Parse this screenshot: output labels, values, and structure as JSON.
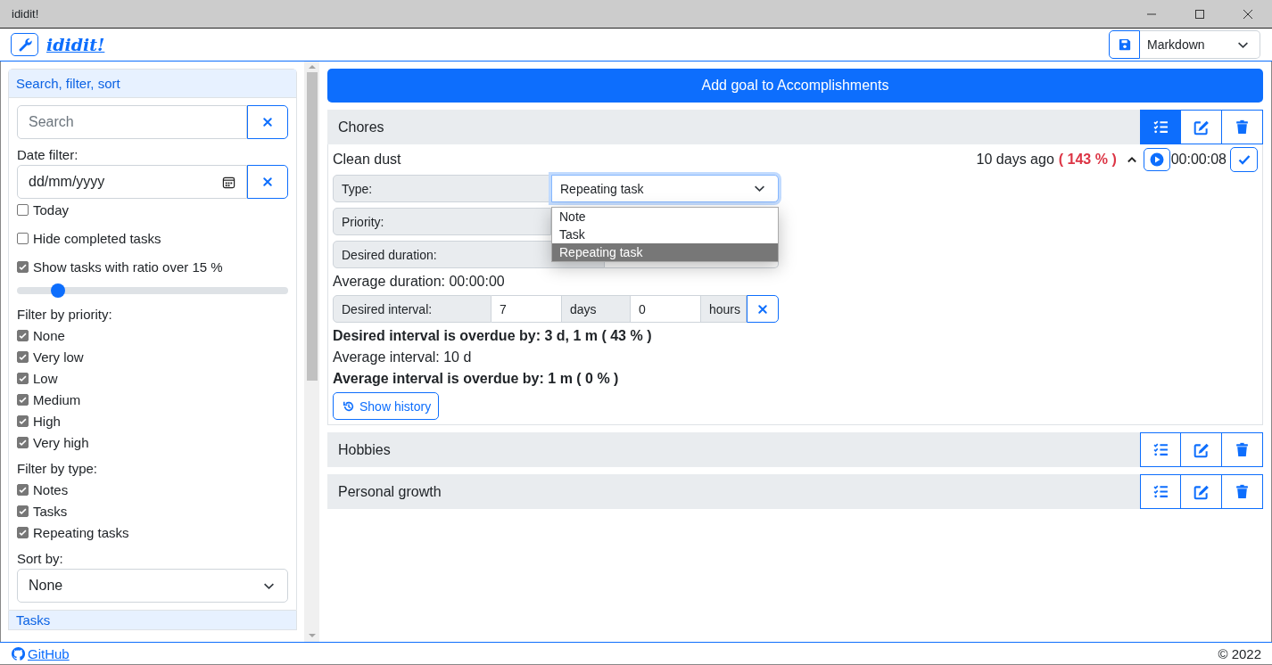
{
  "window": {
    "title": "ididit!"
  },
  "header": {
    "logo": "ididit!",
    "export_format": "Markdown"
  },
  "sidebar": {
    "title": "Search, filter, sort",
    "search_placeholder": "Search",
    "date_label": "Date filter:",
    "date_placeholder": "dd/mm/yyyy",
    "options": [
      {
        "label": "Today",
        "checked": false
      },
      {
        "label": "Hide completed tasks",
        "checked": false
      },
      {
        "label": "Show tasks with ratio over 15 %",
        "checked": true
      }
    ],
    "ratio": {
      "level": 0.15
    },
    "priority_title": "Filter by priority:",
    "priorities": [
      {
        "label": "None",
        "checked": true
      },
      {
        "label": "Very low",
        "checked": true
      },
      {
        "label": "Low",
        "checked": true
      },
      {
        "label": "Medium",
        "checked": true
      },
      {
        "label": "High",
        "checked": true
      },
      {
        "label": "Very high",
        "checked": true
      }
    ],
    "type_title": "Filter by type:",
    "types": [
      {
        "label": "Notes",
        "checked": true
      },
      {
        "label": "Tasks",
        "checked": true
      },
      {
        "label": "Repeating tasks",
        "checked": true
      }
    ],
    "sort_label": "Sort by:",
    "sort_value": "None",
    "next_section": "Tasks"
  },
  "main": {
    "add_button": "Add goal to Accomplishments",
    "goals": [
      {
        "name": "Chores",
        "expanded": true,
        "tasks": [
          {
            "name": "Clean dust",
            "last_done": "10 days ago",
            "ratio": "( 143 % )",
            "timer": "00:00:08",
            "type_label": "Type:",
            "type_value": "Repeating task",
            "type_options": [
              {
                "label": "Note",
                "selected": false
              },
              {
                "label": "Task",
                "selected": false
              },
              {
                "label": "Repeating task",
                "selected": true
              }
            ],
            "priority_label": "Priority:",
            "duration_label": "Desired duration:",
            "average_duration": "Average duration: 00:00:00",
            "interval_label": "Desired interval:",
            "interval_days": "7",
            "days_unit": "days",
            "interval_hours": "0",
            "hours_unit": "hours",
            "stats": [
              {
                "text": "Desired interval is overdue by: 3 d, 1 m ( 43 % )",
                "bold": true
              },
              {
                "text": "Average interval: 10 d",
                "bold": false
              },
              {
                "text": "Average interval is overdue by: 1 m ( 0 % )",
                "bold": true
              }
            ],
            "history_button": "Show history"
          }
        ]
      },
      {
        "name": "Hobbies",
        "expanded": false
      },
      {
        "name": "Personal growth",
        "expanded": false
      }
    ]
  },
  "footer": {
    "link": "GitHub",
    "copyright": "© 2022"
  }
}
